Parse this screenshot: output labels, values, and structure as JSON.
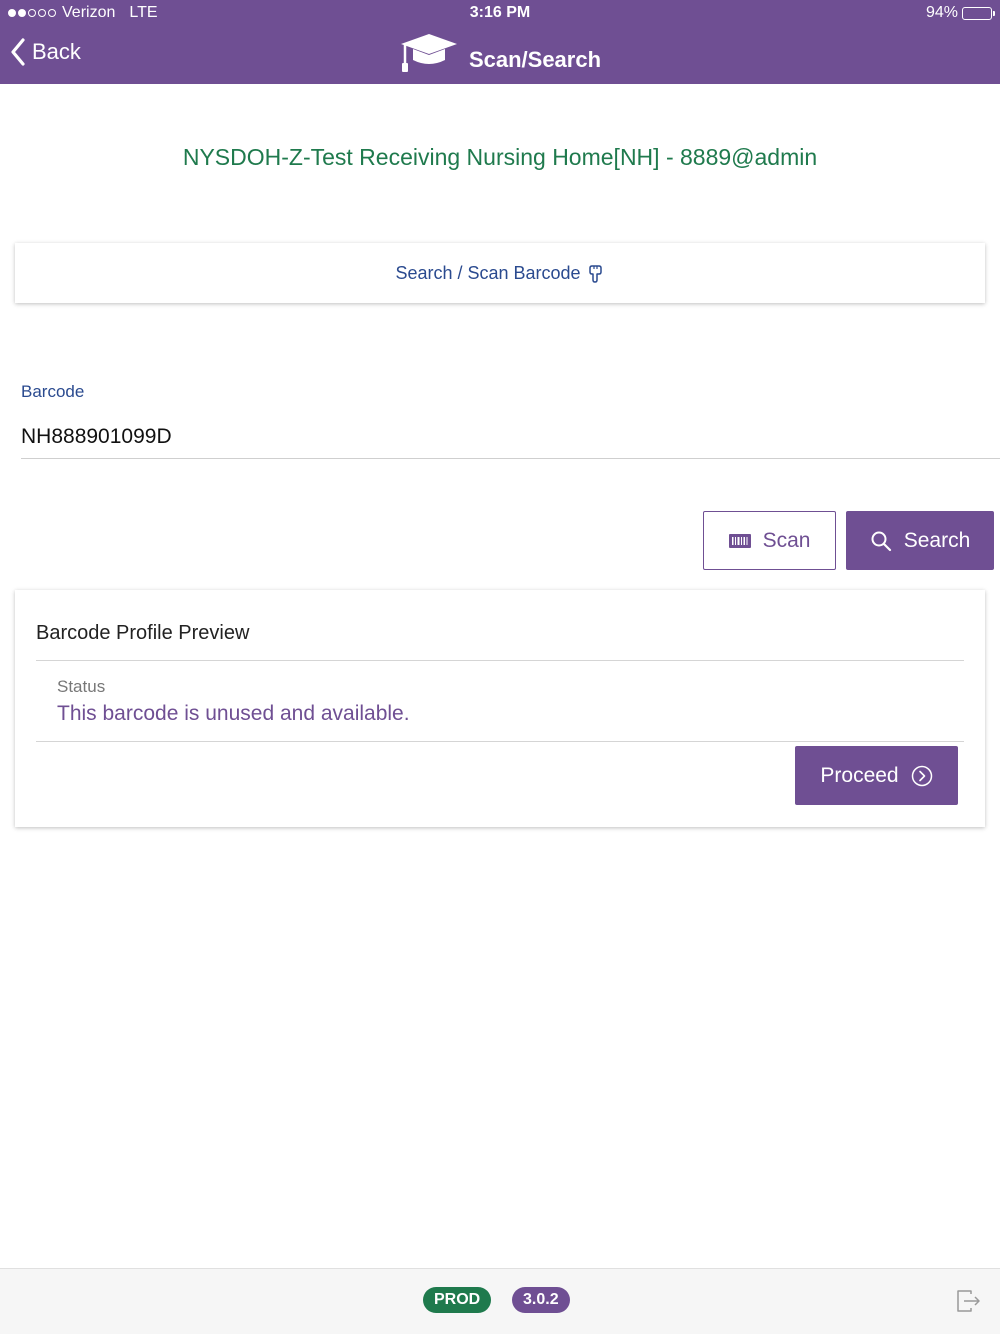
{
  "status_bar": {
    "carrier": "Verizon",
    "network": "LTE",
    "time": "3:16 PM",
    "battery": "94%",
    "battery_level": 0.94,
    "signal_bars_filled": 2,
    "signal_bars_total": 5
  },
  "nav": {
    "back_label": "Back",
    "title": "Scan/Search",
    "title_icon": "graduation-cap-icon"
  },
  "facility": "NYSDOH-Z-Test Receiving Nursing Home[NH] - 8889@admin",
  "mode_toggle": {
    "label": "Search / Scan Barcode",
    "icon": "hand-pointer-icon"
  },
  "barcode_field": {
    "label": "Barcode",
    "value": "NH888901099D"
  },
  "actions": {
    "scan_label": "Scan",
    "scan_icon": "barcode-icon",
    "search_label": "Search",
    "search_icon": "search-icon"
  },
  "preview": {
    "title": "Barcode Profile Preview",
    "status_label": "Status",
    "status_text": "This barcode is unused and available.",
    "proceed_label": "Proceed",
    "proceed_icon": "chevron-circle-right-icon"
  },
  "footer": {
    "env": "PROD",
    "version": "3.0.2",
    "logout_icon": "logout-icon"
  },
  "colors": {
    "primary": "#6f4f93",
    "facility_green": "#1f7a4d",
    "link_blue": "#2a4a8f"
  }
}
